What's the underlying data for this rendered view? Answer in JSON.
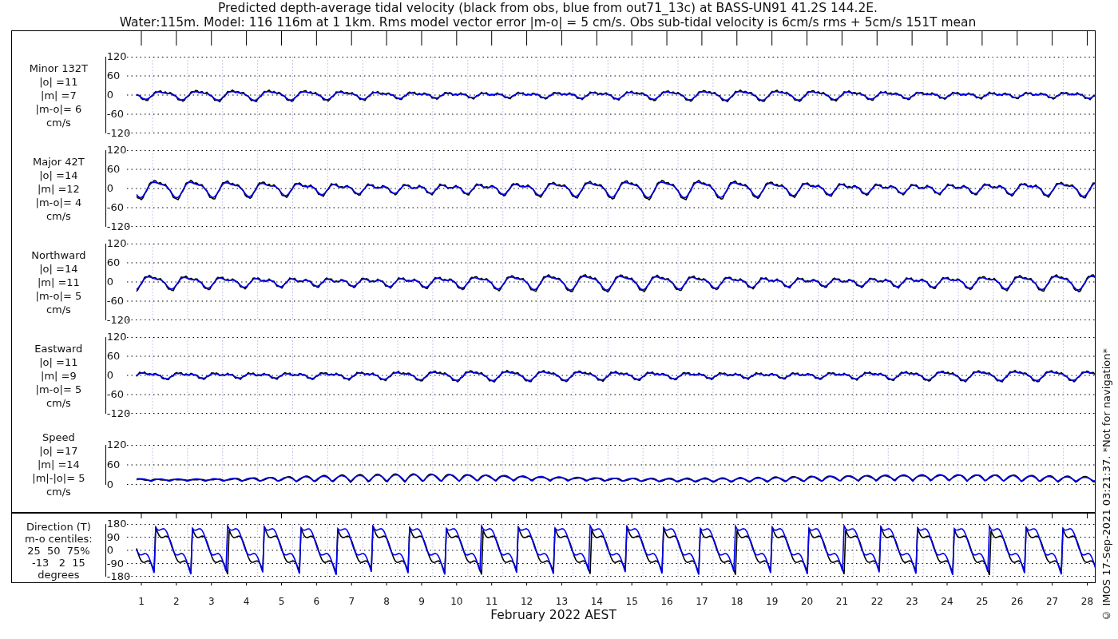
{
  "title_lines": [
    "Predicted depth-average tidal velocity (black from obs, blue from out71_13c) at BASS-UN91 41.2S 144.2E.",
    "Water:115m. Model: 116 116m at 1 1km. Rms model vector error |m-o| = 5 cm/s. Obs sub-tidal velocity is 6cm/s rms + 5cm/s 151T mean"
  ],
  "panels": [
    {
      "kind": "velocity",
      "label_lines": [
        "Minor 132T",
        "|o| =11",
        "|m| =7",
        "|m-o|= 6",
        "cm/s"
      ],
      "yticks": [
        "120",
        "60",
        "0",
        "-60",
        "-120"
      ]
    },
    {
      "kind": "velocity",
      "label_lines": [
        "Major 42T",
        "|o| =14",
        "|m| =12",
        "|m-o|= 4",
        "cm/s"
      ],
      "yticks": [
        "120",
        "60",
        "0",
        "-60",
        "-120"
      ]
    },
    {
      "kind": "velocity",
      "label_lines": [
        "Northward",
        "|o| =14",
        "|m| =11",
        "|m-o|= 5",
        "cm/s"
      ],
      "yticks": [
        "120",
        "60",
        "0",
        "-60",
        "-120"
      ]
    },
    {
      "kind": "velocity",
      "label_lines": [
        "Eastward",
        "|o| =11",
        "|m| =9",
        "|m-o|= 5",
        "cm/s"
      ],
      "yticks": [
        "120",
        "60",
        "0",
        "-60",
        "-120"
      ]
    },
    {
      "kind": "speed",
      "label_lines": [
        "Speed",
        "|o| =17",
        "|m| =14",
        "|m|-|o|= 5",
        "cm/s"
      ],
      "yticks": [
        "120",
        "60",
        "0"
      ]
    },
    {
      "kind": "direction",
      "label_lines": [
        "Direction (T)",
        "m-o centiles:",
        "25  50  75%",
        "-13   2  15",
        "degrees"
      ],
      "yticks": [
        "180",
        "90",
        "0",
        "-90",
        "-180"
      ]
    }
  ],
  "xticks": [
    "1",
    "2",
    "3",
    "4",
    "5",
    "6",
    "7",
    "8",
    "9",
    "10",
    "11",
    "12",
    "13",
    "14",
    "15",
    "16",
    "17",
    "18",
    "19",
    "20",
    "21",
    "22",
    "23",
    "24",
    "25",
    "26",
    "27",
    "28"
  ],
  "xlabel": "February 2022 AEST",
  "credit": "© IMOS 17-Sep-2021 03:21:37. *Not for navigation*"
}
